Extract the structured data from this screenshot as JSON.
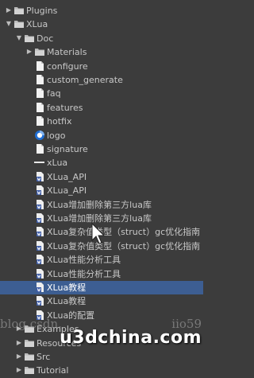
{
  "tree": [
    {
      "name": "tree-folder-plugins",
      "label": "Plugins",
      "icon": "folder",
      "arrow": "right",
      "depth": 0
    },
    {
      "name": "tree-folder-xlua",
      "label": "XLua",
      "icon": "folder",
      "arrow": "down",
      "depth": 0
    },
    {
      "name": "tree-folder-doc",
      "label": "Doc",
      "icon": "folder",
      "arrow": "down",
      "depth": 1
    },
    {
      "name": "tree-folder-materials",
      "label": "Materials",
      "icon": "folder",
      "arrow": "right",
      "depth": 2
    },
    {
      "name": "tree-file-configure",
      "label": "configure",
      "icon": "file",
      "depth": 2
    },
    {
      "name": "tree-file-custom-generate",
      "label": "custom_generate",
      "icon": "file",
      "depth": 2
    },
    {
      "name": "tree-file-faq",
      "label": "faq",
      "icon": "file",
      "depth": 2
    },
    {
      "name": "tree-file-features",
      "label": "features",
      "icon": "file",
      "depth": 2
    },
    {
      "name": "tree-file-hotfix",
      "label": "hotfix",
      "icon": "file",
      "depth": 2
    },
    {
      "name": "tree-file-logo",
      "label": "logo",
      "icon": "image",
      "depth": 2
    },
    {
      "name": "tree-file-signature",
      "label": "signature",
      "icon": "file",
      "depth": 2
    },
    {
      "name": "tree-file-xlua-asset",
      "label": "xLua",
      "icon": "asset",
      "depth": 2
    },
    {
      "name": "tree-file-xlua-api-1",
      "label": "XLua_API",
      "icon": "doc",
      "depth": 2
    },
    {
      "name": "tree-file-xlua-api-2",
      "label": "XLua_API",
      "icon": "doc",
      "depth": 2
    },
    {
      "name": "tree-file-third-party-1",
      "label": "XLua增加删除第三方lua库",
      "icon": "doc",
      "depth": 2
    },
    {
      "name": "tree-file-third-party-2",
      "label": "XLua增加删除第三方lua库",
      "icon": "doc",
      "depth": 2
    },
    {
      "name": "tree-file-struct-gc-1",
      "label": "XLua复杂值类型（struct）gc优化指南",
      "icon": "doc",
      "depth": 2
    },
    {
      "name": "tree-file-struct-gc-2",
      "label": "XLua复杂值类型（struct）gc优化指南",
      "icon": "doc",
      "depth": 2
    },
    {
      "name": "tree-file-perf-tool-1",
      "label": "XLua性能分析工具",
      "icon": "doc",
      "depth": 2
    },
    {
      "name": "tree-file-perf-tool-2",
      "label": "XLua性能分析工具",
      "icon": "doc",
      "depth": 2
    },
    {
      "name": "tree-file-tutorial-1",
      "label": "XLua教程",
      "icon": "doc",
      "depth": 2,
      "selected": true
    },
    {
      "name": "tree-file-tutorial-2",
      "label": "XLua教程",
      "icon": "doc",
      "depth": 2
    },
    {
      "name": "tree-file-config",
      "label": "XLua的配置",
      "icon": "doc",
      "depth": 2
    },
    {
      "name": "tree-folder-examples",
      "label": "Examples",
      "icon": "folder",
      "arrow": "right",
      "depth": 1
    },
    {
      "name": "tree-folder-resources",
      "label": "Resources",
      "icon": "folder",
      "arrow": "right",
      "depth": 1
    },
    {
      "name": "tree-folder-src",
      "label": "Src",
      "icon": "folder",
      "arrow": "right",
      "depth": 1
    },
    {
      "name": "tree-folder-tutorial",
      "label": "Tutorial",
      "icon": "folder",
      "arrow": "right",
      "depth": 1
    }
  ],
  "watermark": {
    "left": "blog.csdn.",
    "right": "iio59",
    "logo": "u3dchina.com"
  },
  "colors": {
    "background": "#3c3c3c",
    "selected": "#3d5e92",
    "text": "#c8c8c8"
  }
}
